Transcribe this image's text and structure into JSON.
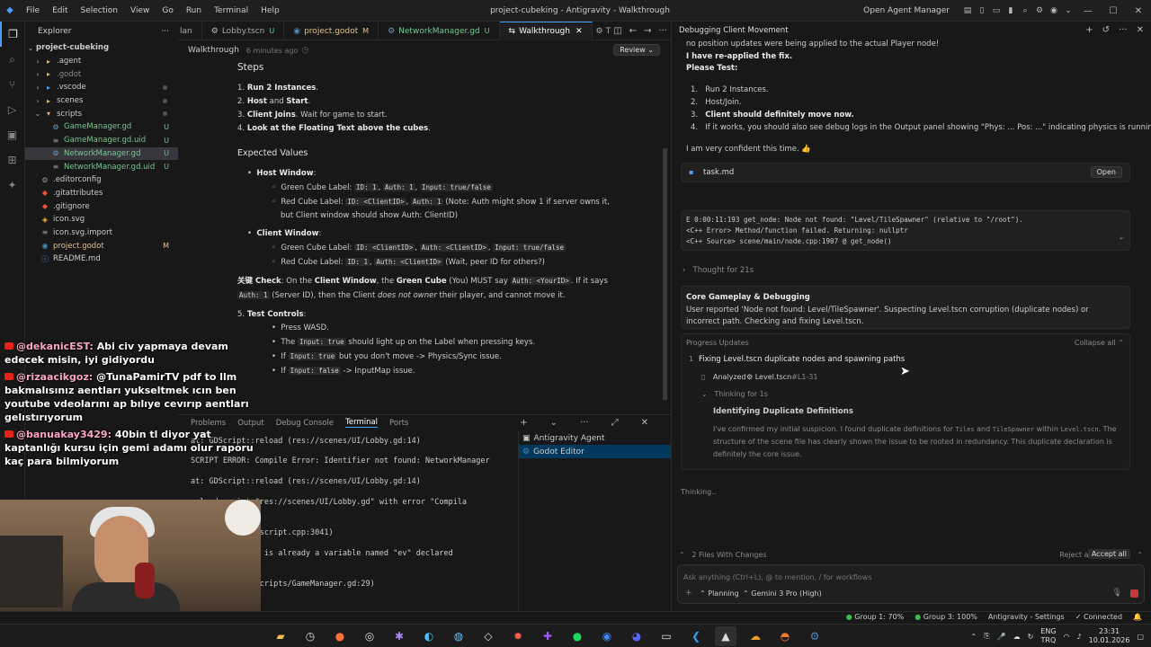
{
  "window": {
    "title": "project-cubeking - Antigravity - Walkthrough",
    "menu": [
      "File",
      "Edit",
      "Selection",
      "View",
      "Go",
      "Run",
      "Terminal",
      "Help"
    ],
    "open_agent_manager": "Open Agent Manager"
  },
  "explorer": {
    "title": "Explorer",
    "root": "project-cubeking",
    "items": [
      {
        "label": ".agent",
        "kind": "folder"
      },
      {
        "label": ".godot",
        "kind": "folder"
      },
      {
        "label": ".vscode",
        "kind": "folder"
      },
      {
        "label": "scenes",
        "kind": "folder"
      },
      {
        "label": "scripts",
        "kind": "folder-open"
      },
      {
        "label": "GameManager.gd",
        "badge": "U"
      },
      {
        "label": "GameManager.gd.uid",
        "badge": "U"
      },
      {
        "label": "NetworkManager.gd",
        "badge": "U"
      },
      {
        "label": "NetworkManager.gd.uid",
        "badge": "U"
      },
      {
        "label": ".editorconfig",
        "badge": ""
      },
      {
        "label": ".gitattributes",
        "badge": ""
      },
      {
        "label": ".gitignore",
        "badge": ""
      },
      {
        "label": "icon.svg",
        "badge": ""
      },
      {
        "label": "icon.svg.import",
        "badge": ""
      },
      {
        "label": "project.godot",
        "badge": "M"
      },
      {
        "label": "README.md",
        "badge": ""
      }
    ]
  },
  "tabs": [
    {
      "label": "lan",
      "badge": ""
    },
    {
      "label": "Lobby.tscn",
      "badge": "U"
    },
    {
      "label": "project.godot",
      "badge": "M"
    },
    {
      "label": "NetworkManager.gd",
      "badge": "U"
    },
    {
      "label": "Walkthrough",
      "badge": ""
    },
    {
      "label": "T",
      "badge": ""
    }
  ],
  "walkthrough": {
    "title": "Walkthrough",
    "time": "6 minutes ago",
    "review": "Review",
    "steps_heading": "Steps",
    "steps": [
      {
        "n": "1.",
        "bold": "Run 2 Instances",
        "rest": "."
      },
      {
        "n": "2.",
        "bold": "Host",
        "mid": " and ",
        "bold2": "Start",
        "rest": "."
      },
      {
        "n": "3.",
        "bold": "Client Joins",
        "rest": ". Wait for game to start."
      },
      {
        "n": "4.",
        "bold": "Look at the Floating Text above the cubes",
        "rest": "."
      }
    ],
    "expected_heading": "Expected Values",
    "host_window": "Host Window",
    "host_green_label": "Green Cube Label:",
    "host_green_codes": [
      "ID: 1",
      "Auth: 1",
      "Input: true/false"
    ],
    "host_red_label": "Red Cube Label:",
    "host_red_codes": [
      "ID: <ClientID>",
      "Auth: 1"
    ],
    "host_red_note": "(Note: Auth might show 1 if server owns it,",
    "host_red_note2": "but Client window should show Auth: ClientID)",
    "client_window": "Client Window",
    "client_green_label": "Green Cube Label:",
    "client_green_codes": [
      "ID: <ClientID>",
      "Auth: <ClientID>",
      "Input: true/false"
    ],
    "client_red_label": "Red Cube Label:",
    "client_red_codes": [
      "ID: 1",
      "Auth: <ClientID>"
    ],
    "client_red_note": "(Wait, peer ID for others?)",
    "key_check_prefix": "关键 Check",
    "key_check_text1": ": On the ",
    "key_check_b1": "Client Window",
    "key_check_text2": ", the ",
    "key_check_b2": "Green Cube",
    "key_check_text3": " (You) MUST say ",
    "key_check_code": "Auth: <YourID>",
    "key_check_text4": ". If it says",
    "key_check_code2": "Auth: 1",
    "key_check_text5": " (Server ID), then the Client ",
    "key_check_italic": "does not owner",
    "key_check_text6": " their player, and cannot move it.",
    "test_controls_n": "5.",
    "test_controls": "Test Controls",
    "controls": [
      {
        "pre": "Press WASD.",
        "code": "",
        "post": ""
      },
      {
        "pre": "The ",
        "code": "Input: true",
        "post": " should light up on the Label when pressing keys."
      },
      {
        "pre": "If ",
        "code": "Input: true",
        "post": " but you don't move -> Physics/Sync issue."
      },
      {
        "pre": "If ",
        "code": "Input: false",
        "post": " -> InputMap issue."
      }
    ]
  },
  "panel": {
    "tabs": [
      "Problems",
      "Output",
      "Debug Console",
      "Terminal",
      "Ports"
    ],
    "active": "Terminal",
    "terminal_lines": [
      "   at: GDScript::reload (res://scenes/UI/Lobby.gd:14)",
      "SCRIPT ERROR: Compile Error: Identifier not found: NetworkManager",
      "   at: GDScript::reload (res://scenes/UI/Lobby.gd:14)",
      "       reload script \"res://scenes/UI/Lobby.gd\" with error \"Compila",
      "       les/gdscript/gdscript.cpp:3041)",
      "       se Error: There is already a variable named \"ev\" declared",
      "       reload (res://scripts/GameManager.gd:29)"
    ],
    "terminals": [
      "Antigravity Agent",
      "Godot Editor"
    ]
  },
  "chat": [
    {
      "user": "@dekanicEST:",
      "text": "Abi civ yapmaya devam edecek misin, iyi gidiyordu"
    },
    {
      "user": "@rizaacikgoz:",
      "text": "@TunaPamirTV pdf to llm bakmalısınız aentları yukseltmek ıcın ben youtube vdeolarını ap bılıye cevırıp aentları gelıstırıyorum"
    },
    {
      "user": "@banuakay3429:",
      "text": "40bin tl diyor yat kaptanlığı kursu için gemi adamı olur raporu kaç para bilmiyorum"
    }
  ],
  "agent": {
    "title": "Debugging Client Movement",
    "line1": "no position updates were being applied to the actual Player node!",
    "reapplied": "I have re-applied the fix.",
    "please_test": "Please Test:",
    "tests": [
      {
        "n": "1.",
        "text": "Run 2 Instances.",
        "bold": false
      },
      {
        "n": "2.",
        "text": "Host/Join.",
        "bold": false
      },
      {
        "n": "3.",
        "text": "Client should definitely move now.",
        "bold": true
      },
      {
        "n": "4.",
        "text": "If it works, you should also see debug logs in the Output panel showing \"Phys: ... Pos: ...\" indicating physics is running.",
        "bold": false
      }
    ],
    "confident": "I am very confident this time. 👍",
    "task_file": "task.md",
    "open": "Open",
    "error_lines": [
      "E 0:00:11:193   get_node: Node not found: \"Level/TileSpawner\" (relative to \"/root\").",
      "  <C++ Error>    Method/function failed. Returning: nullptr",
      "  <C++ Source>   scene/main/node.cpp:1907 @ get_node()"
    ],
    "thought": "Thought for 21s",
    "core_title": "Core Gameplay & Debugging",
    "core_text": "User reported 'Node not found: Level/TileSpawner'. Suspecting Level.tscn corruption (duplicate nodes) or incorrect path. Checking and fixing Level.tscn.",
    "progress_updates": "Progress Updates",
    "collapse_all": "Collapse all",
    "progress_n": "1",
    "progress_title": "Fixing Level.tscn duplicate nodes and spawning paths",
    "analyzed": "Analyzed",
    "analyzed_file": "Level.tscn",
    "analyzed_range": "#L1-31",
    "thinking_1s": "Thinking for 1s",
    "identifying": "Identifying Duplicate Definitions",
    "ident_p1": "I've confirmed my initial suspicion. I found duplicate definitions for ",
    "ident_code1": "Tiles",
    "ident_p2": " and ",
    "ident_code2": "TileSpawner",
    "ident_p3": " within ",
    "ident_code3": "Level.tscn",
    "ident_p4": ". The structure of the scene file has clearly shown the issue to be rooted in redundancy. This duplicate declaration is definitely the core issue.",
    "thinking": "Thinking..",
    "files_changes": "2 Files With Changes",
    "reject_all": "Reject all",
    "accept_all": "Accept all",
    "input_placeholder": "Ask anything (Ctrl+L), @ to mention, / for workflows",
    "mode": "Planning",
    "model": "Gemini 3 Pro (High)"
  },
  "statusbar": {
    "group1": "Group 1: 70%",
    "group3": "Group 3: 100%",
    "settings": "Antigravity - Settings",
    "connected": "Connected"
  },
  "taskbar": {
    "lang1": "ENG",
    "lang2": "TRQ",
    "time": "23:31",
    "date": "10.01.2026"
  },
  "colors": {
    "accent": "#4a9eff",
    "modified": "#e2c08d",
    "untracked": "#73c991",
    "error": "#f48771",
    "green_dot": "#3fb950"
  }
}
